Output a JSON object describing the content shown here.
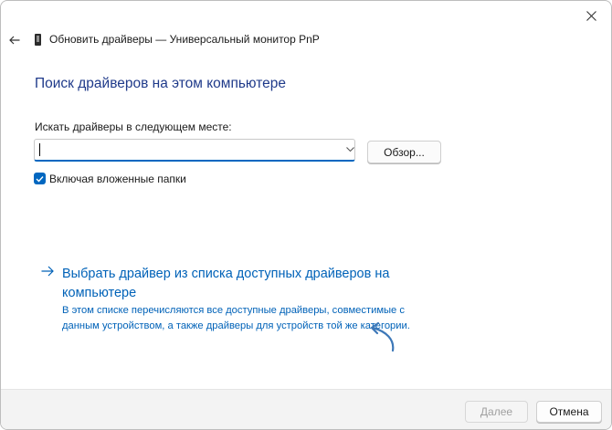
{
  "window": {
    "title": "Обновить драйверы — Универсальный монитор PnP",
    "close_icon": "close-icon",
    "back_icon": "arrow-left-icon",
    "device_icon": "monitor-device-icon"
  },
  "main": {
    "heading": "Поиск драйверов на этом компьютере",
    "search_label": "Искать драйверы в следующем месте:",
    "path_value": "",
    "path_placeholder": "",
    "browse_label": "Обзор...",
    "include_subfolders": {
      "label": "Включая вложенные папки",
      "checked": true
    },
    "pick_link": {
      "icon": "arrow-right-icon",
      "text": "Выбрать драйвер из списка доступных драйверов на компьютере",
      "description": "В этом списке перечисляются все доступные драйверы, совместимые с данным устройством, а также драйверы для устройств той же категории."
    }
  },
  "footer": {
    "next_label": "Далее",
    "next_enabled": false,
    "cancel_label": "Отмена"
  },
  "colors": {
    "accent": "#0067c0",
    "link": "#0062b8",
    "heading": "#1f3a8a",
    "footer_bg": "#f3f3f3",
    "annotation_arrow": "#3d78b8"
  }
}
